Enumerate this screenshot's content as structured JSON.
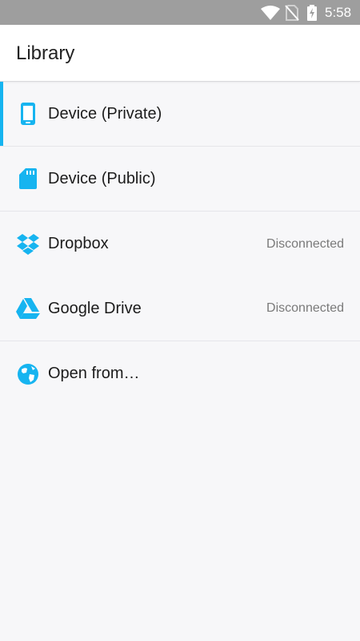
{
  "status_bar": {
    "time": "5:58",
    "icons": [
      "wifi-icon",
      "no-sim-icon",
      "battery-charging-icon"
    ]
  },
  "app_bar": {
    "title": "Library"
  },
  "accent_color": "#16b4f0",
  "library": {
    "items": [
      {
        "label": "Device (Private)",
        "icon": "phone-icon",
        "selected": true
      },
      {
        "label": "Device (Public)",
        "icon": "sd-card-icon"
      },
      {
        "label": "Dropbox",
        "icon": "dropbox-icon",
        "status": "Disconnected"
      },
      {
        "label": "Google Drive",
        "icon": "google-drive-icon",
        "status": "Disconnected"
      },
      {
        "label": "Open from…",
        "icon": "globe-icon"
      }
    ]
  }
}
